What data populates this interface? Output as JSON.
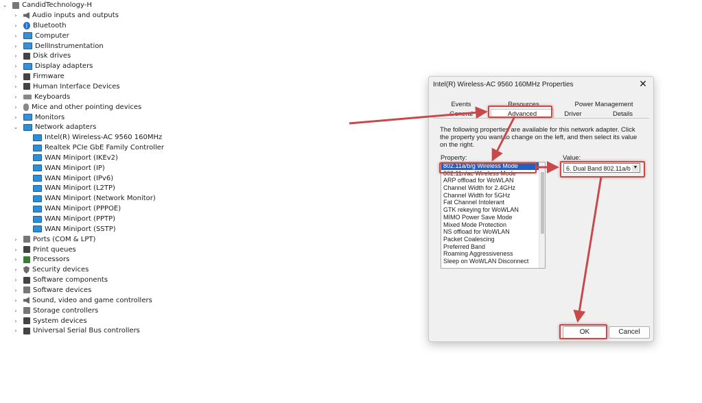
{
  "device_manager": {
    "root": "CandidTechnology-H",
    "categories": [
      {
        "label": "Audio inputs and outputs"
      },
      {
        "label": "Bluetooth"
      },
      {
        "label": "Computer"
      },
      {
        "label": "DellInstrumentation"
      },
      {
        "label": "Disk drives"
      },
      {
        "label": "Display adapters"
      },
      {
        "label": "Firmware"
      },
      {
        "label": "Human Interface Devices"
      },
      {
        "label": "Keyboards"
      },
      {
        "label": "Mice and other pointing devices"
      },
      {
        "label": "Monitors"
      },
      {
        "label": "Network adapters"
      },
      {
        "label": "Ports (COM & LPT)"
      },
      {
        "label": "Print queues"
      },
      {
        "label": "Processors"
      },
      {
        "label": "Security devices"
      },
      {
        "label": "Software components"
      },
      {
        "label": "Software devices"
      },
      {
        "label": "Sound, video and game controllers"
      },
      {
        "label": "Storage controllers"
      },
      {
        "label": "System devices"
      },
      {
        "label": "Universal Serial Bus controllers"
      }
    ],
    "network_adapters": [
      "Intel(R) Wireless-AC 9560 160MHz",
      "Realtek PCIe GbE Family Controller",
      "WAN Miniport (IKEv2)",
      "WAN Miniport (IP)",
      "WAN Miniport (IPv6)",
      "WAN Miniport (L2TP)",
      "WAN Miniport (Network Monitor)",
      "WAN Miniport (PPPOE)",
      "WAN Miniport (PPTP)",
      "WAN Miniport (SSTP)"
    ]
  },
  "dialog": {
    "title": "Intel(R) Wireless-AC 9560 160MHz Properties",
    "close": "✕",
    "tabs": {
      "events": "Events",
      "resources": "Resources",
      "power": "Power Management",
      "general": "General",
      "advanced": "Advanced",
      "driver": "Driver",
      "details": "Details"
    },
    "description": "The following properties are available for this network adapter. Click the property you want to change on the left, and then select its value on the right.",
    "property_label": "Property:",
    "value_label": "Value:",
    "properties": [
      "802.11a/b/g Wireless Mode",
      "802.11n/ac Wireless Mode",
      "ARP offload for WoWLAN",
      "Channel Width for 2.4GHz",
      "Channel Width for 5GHz",
      "Fat Channel Intolerant",
      "GTK rekeying for WoWLAN",
      "MIMO Power Save Mode",
      "Mixed Mode Protection",
      "NS offload for WoWLAN",
      "Packet Coalescing",
      "Preferred Band",
      "Roaming Aggressiveness",
      "Sleep on WoWLAN Disconnect"
    ],
    "value": "6. Dual Band 802.11a/b",
    "ok": "OK",
    "cancel": "Cancel"
  },
  "colors": {
    "highlight": "#c9494b",
    "selection": "#1a62c9"
  }
}
